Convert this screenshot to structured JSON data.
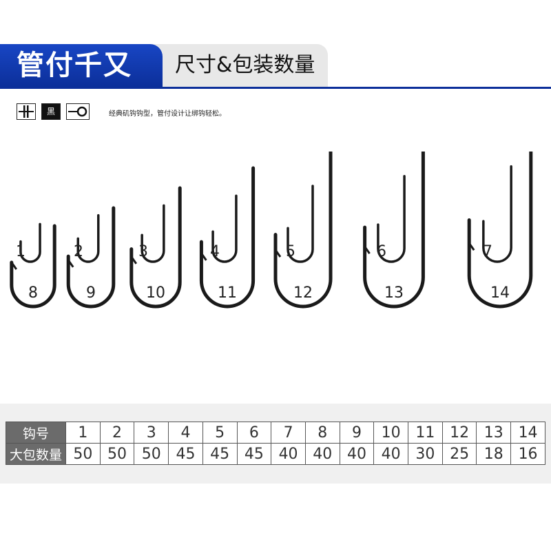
{
  "header": {
    "title": "管付千又",
    "subtitle": "尺寸&包装数量"
  },
  "features": {
    "icons": [
      "barbed-hook-icon",
      "black-color-icon",
      "ring-eye-icon"
    ],
    "color_badge": "黑",
    "description": "经典矶钩钩型，管付设计让绑钩轻松。"
  },
  "hooks": {
    "pairs": [
      {
        "small": "1",
        "large": "8"
      },
      {
        "small": "2",
        "large": "9"
      },
      {
        "small": "3",
        "large": "10"
      },
      {
        "small": "4",
        "large": "11"
      },
      {
        "small": "5",
        "large": "12"
      },
      {
        "small": "6",
        "large": "13"
      },
      {
        "small": "7",
        "large": "14"
      }
    ]
  },
  "table": {
    "row1_header": "钩号",
    "row2_header": "大包数量",
    "sizes": [
      "1",
      "2",
      "3",
      "4",
      "5",
      "6",
      "7",
      "8",
      "9",
      "10",
      "11",
      "12",
      "13",
      "14"
    ],
    "quantities": [
      "50",
      "50",
      "50",
      "45",
      "45",
      "45",
      "40",
      "40",
      "40",
      "40",
      "30",
      "25",
      "18",
      "16"
    ]
  },
  "colors": {
    "brand_blue": "#0c2f9a",
    "table_header_gray": "#6b6b6b"
  }
}
